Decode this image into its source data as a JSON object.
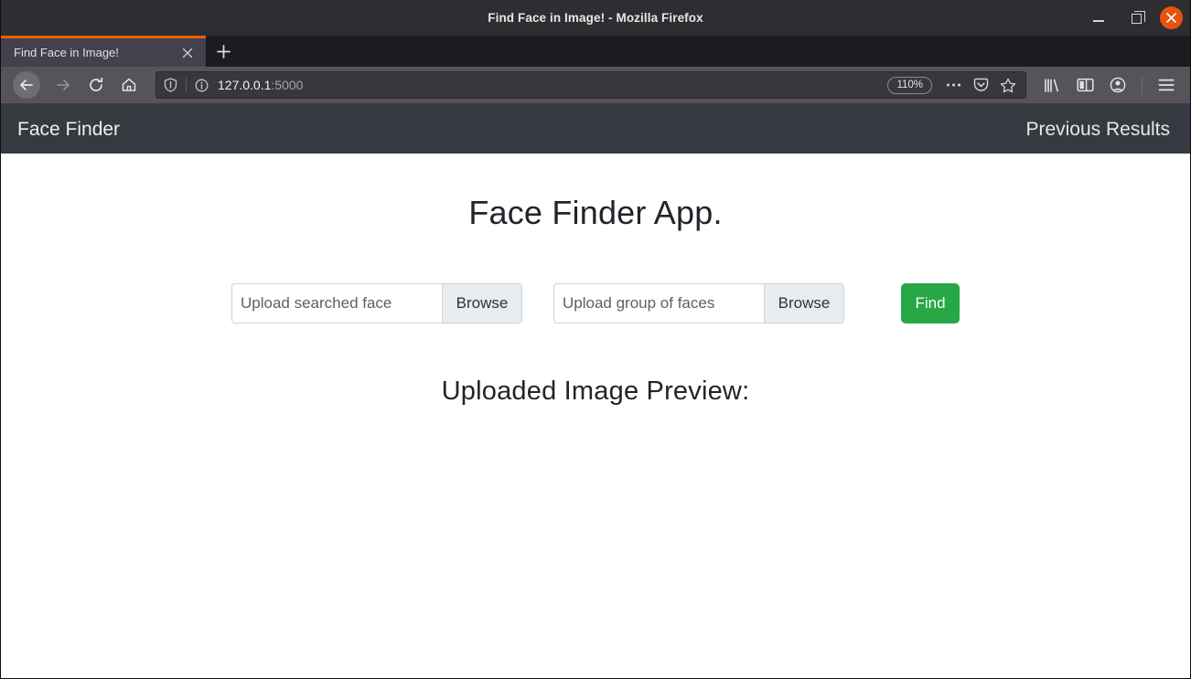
{
  "window": {
    "title": "Find Face in Image! - Mozilla Firefox",
    "controls": {
      "minimize": "minimize-icon",
      "maximize": "restore-icon",
      "close": "close-icon"
    }
  },
  "browser": {
    "tab": {
      "title": "Find Face in Image!",
      "close_icon": "close-icon"
    },
    "new_tab_label": "+",
    "nav": {
      "back_icon": "arrow-left-icon",
      "forward_icon": "arrow-right-icon",
      "reload_icon": "reload-icon",
      "home_icon": "home-icon"
    },
    "urlbar": {
      "shield_icon": "shield-icon",
      "info_icon": "info-circle-icon",
      "host": "127.0.0.1",
      "port": ":5000",
      "zoom_level": "110%",
      "page_actions_icon": "ellipsis-icon",
      "pocket_icon": "pocket-icon",
      "bookmark_icon": "star-icon"
    },
    "tools": {
      "library_icon": "library-icon",
      "sidebar_icon": "sidebar-icon",
      "account_icon": "account-icon",
      "menu_icon": "hamburger-menu-icon"
    }
  },
  "site": {
    "navbar": {
      "brand": "Face Finder",
      "links": [
        {
          "label": "Previous Results"
        }
      ]
    },
    "heading": "Face Finder App.",
    "form": {
      "inputs": [
        {
          "placeholder": "Upload searched face",
          "browse_label": "Browse"
        },
        {
          "placeholder": "Upload group of faces",
          "browse_label": "Browse"
        }
      ],
      "submit_label": "Find"
    },
    "preview_heading": "Uploaded Image Preview:"
  },
  "colors": {
    "navbar_bg": "#343a40",
    "accent_green": "#28a745",
    "tab_accent": "#e66000",
    "close_button": "#e8520f"
  }
}
